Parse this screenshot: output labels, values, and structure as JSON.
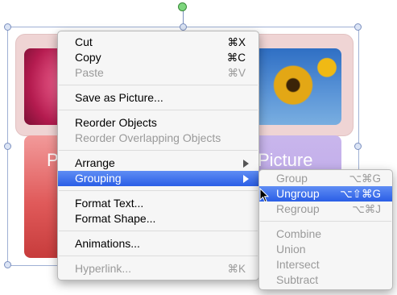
{
  "slide": {
    "tile_label_left": "Pi",
    "tile_label_right": "Picture"
  },
  "context_menu": {
    "items": [
      {
        "label": "Cut",
        "shortcut": "⌘X",
        "enabled": true
      },
      {
        "label": "Copy",
        "shortcut": "⌘C",
        "enabled": true
      },
      {
        "label": "Paste",
        "shortcut": "⌘V",
        "enabled": false
      },
      {
        "label": "Save as Picture...",
        "shortcut": "",
        "enabled": true
      },
      {
        "label": "Reorder Objects",
        "shortcut": "",
        "enabled": true
      },
      {
        "label": "Reorder Overlapping Objects",
        "shortcut": "",
        "enabled": false
      },
      {
        "label": "Arrange",
        "shortcut": "",
        "enabled": true,
        "submenu": true
      },
      {
        "label": "Grouping",
        "shortcut": "",
        "enabled": true,
        "submenu": true,
        "highlighted": true
      },
      {
        "label": "Format Text...",
        "shortcut": "",
        "enabled": true
      },
      {
        "label": "Format Shape...",
        "shortcut": "",
        "enabled": true
      },
      {
        "label": "Animations...",
        "shortcut": "",
        "enabled": true
      },
      {
        "label": "Hyperlink...",
        "shortcut": "⌘K",
        "enabled": false
      }
    ]
  },
  "grouping_submenu": {
    "items": [
      {
        "label": "Group",
        "shortcut": "⌥⌘G",
        "enabled": false
      },
      {
        "label": "Ungroup",
        "shortcut": "⌥⇧⌘G",
        "enabled": true,
        "highlighted": true
      },
      {
        "label": "Regroup",
        "shortcut": "⌥⌘J",
        "enabled": false
      },
      {
        "label": "Combine",
        "shortcut": "",
        "enabled": false
      },
      {
        "label": "Union",
        "shortcut": "",
        "enabled": false
      },
      {
        "label": "Intersect",
        "shortcut": "",
        "enabled": false
      },
      {
        "label": "Subtract",
        "shortcut": "",
        "enabled": false
      }
    ]
  },
  "colors": {
    "highlight": "#2a5ee6",
    "disabled_text": "#9a9a9a",
    "band": "#efd4d4"
  },
  "icons": {
    "submenu_arrow": "triangle-right-icon",
    "cursor": "arrow-pointer-icon"
  }
}
